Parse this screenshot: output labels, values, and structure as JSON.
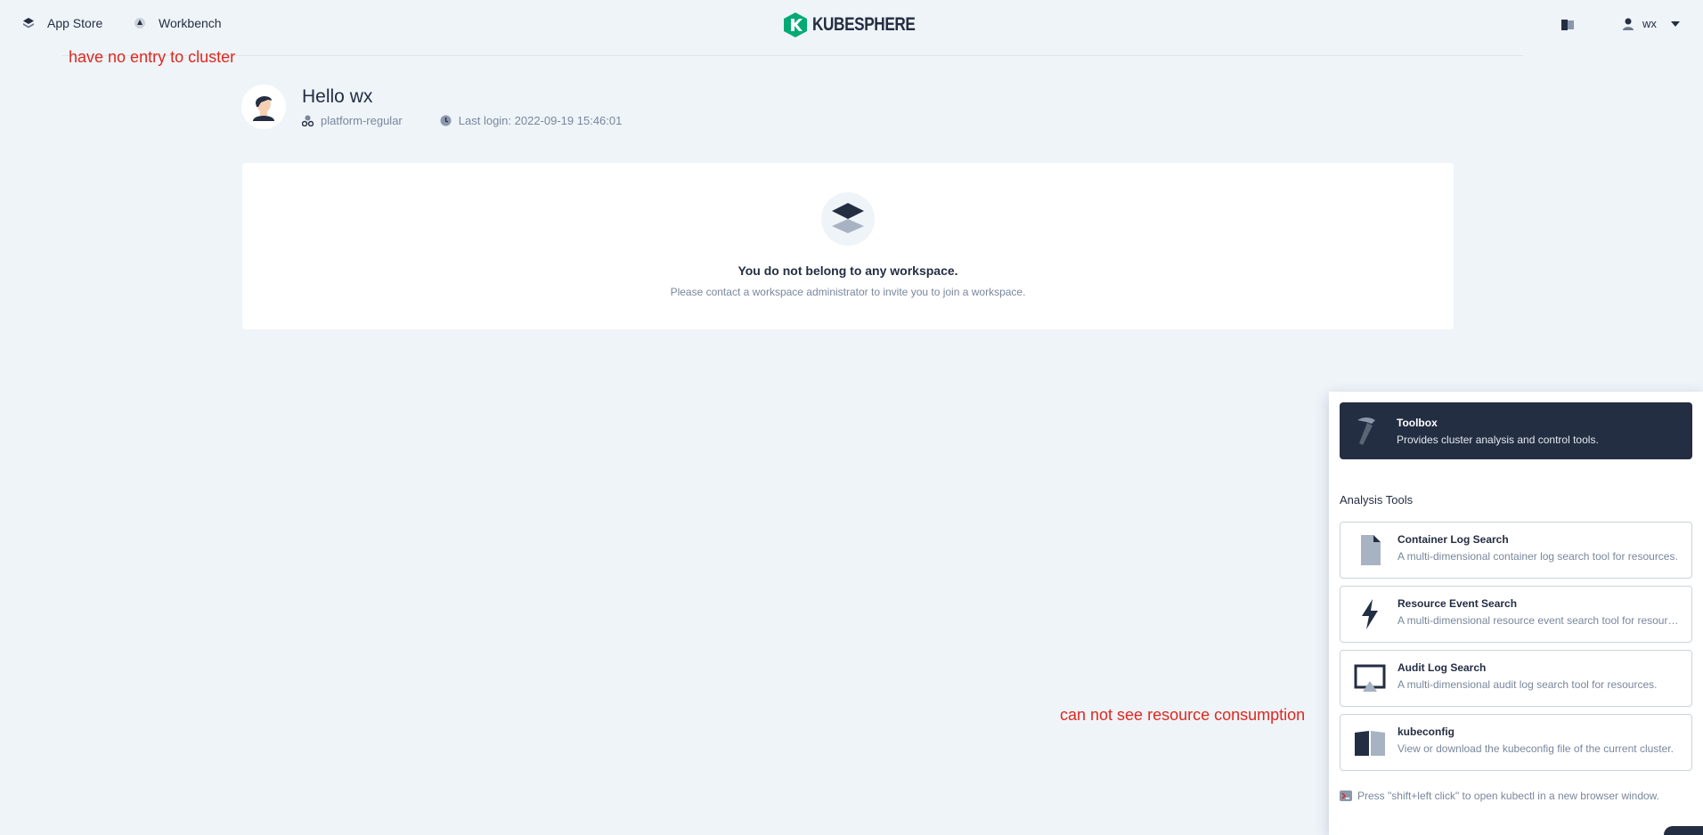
{
  "topbar": {
    "app_store_label": "App Store",
    "workbench_label": "Workbench",
    "logo_text": "KUBESPHERE",
    "user_name": "wx"
  },
  "annotations": {
    "cluster_note": "have no entry to cluster",
    "resource_note": "can not see resource consumption"
  },
  "greeting": {
    "hello": "Hello wx",
    "role": "platform-regular",
    "last_login": "Last login: 2022-09-19 15:46:01"
  },
  "empty_state": {
    "title": "You do not belong to any workspace.",
    "description": "Please contact a workspace administrator to invite you to join a workspace."
  },
  "toolbox": {
    "title": "Toolbox",
    "description": "Provides cluster analysis and control tools.",
    "section_title": "Analysis Tools",
    "tools": [
      {
        "name": "Container Log Search",
        "description": "A multi-dimensional container log search tool for resources.",
        "icon": "file-icon"
      },
      {
        "name": "Resource Event Search",
        "description": "A multi-dimensional resource event search tool for resources.",
        "icon": "lightning-icon"
      },
      {
        "name": "Audit Log Search",
        "description": "A multi-dimensional audit log search tool for resources.",
        "icon": "monitor-icon"
      },
      {
        "name": "kubeconfig",
        "description": "View or download the kubeconfig file of the current cluster.",
        "icon": "book-icon"
      }
    ],
    "kubectl_tip": "Press \"shift+left click\" to open kubectl in a new browser window."
  },
  "colors": {
    "background": "#eff4f9",
    "dark": "#242e42",
    "brand_green": "#00aa72",
    "annotation_red": "#e0281e"
  }
}
